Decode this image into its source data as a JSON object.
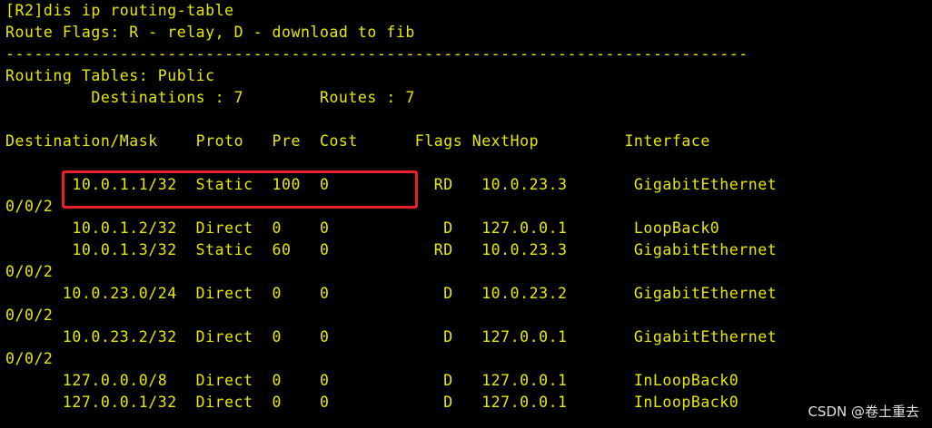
{
  "terminal": {
    "lines": [
      "[R2]dis ip routing-table",
      "Route Flags: R - relay, D - download to fib",
      "------------------------------------------------------------------------------",
      "Routing Tables: Public",
      "         Destinations : 7        Routes : 7",
      "",
      "Destination/Mask    Proto   Pre  Cost      Flags NextHop         Interface",
      "",
      "       10.0.1.1/32  Static  100  0           RD   10.0.23.3       GigabitEthernet",
      "0/0/2",
      "       10.0.1.2/32  Direct  0    0            D   127.0.0.1       LoopBack0",
      "       10.0.1.3/32  Static  60   0           RD   10.0.23.3       GigabitEthernet",
      "0/0/2",
      "      10.0.23.0/24  Direct  0    0            D   10.0.23.2       GigabitEthernet",
      "0/0/2",
      "      10.0.23.2/32  Direct  0    0            D   127.0.0.1       GigabitEthernet",
      "0/0/2",
      "      127.0.0.0/8   Direct  0    0            D   127.0.0.1       InLoopBack0",
      "      127.0.0.1/32  Direct  0    0            D   127.0.0.1       InLoopBack0"
    ]
  },
  "watermark": "CSDN @卷土重去",
  "colors": {
    "background": "#000000",
    "text": "#e8e800",
    "highlight_border": "#e8202a"
  }
}
